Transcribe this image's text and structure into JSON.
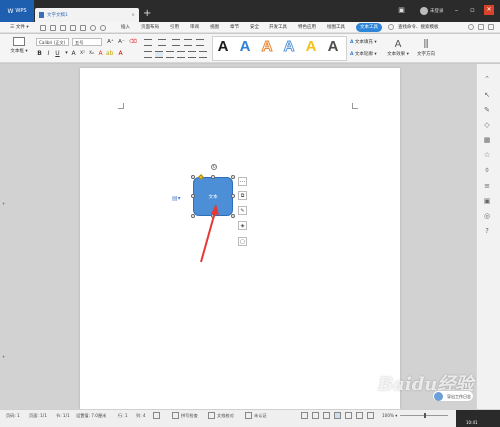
{
  "titlebar": {
    "app_tab": "WPS",
    "doc_tab": "文字文稿1",
    "unlogin": "未登录"
  },
  "menu": {
    "file": "三 文件 ▾",
    "items": [
      "插入",
      "页面布局",
      "引用",
      "审阅",
      "视图",
      "章节",
      "安全",
      "开发工具",
      "特色应用",
      "绘图工具"
    ],
    "active": "文本工具",
    "search": "查找命令、搜索模板"
  },
  "ribbon": {
    "textbox": "文本框 ▾",
    "font": "Calibri (正文)",
    "size": "五号",
    "text_fill": "文本填充 ▾",
    "text_outline": "文本轮廓 ▾",
    "text_effect": "文本效果 ▾",
    "text_direction": "文字方向",
    "styles": [
      {
        "glyph": "A",
        "color": "#1a1a1a",
        "style": "solid"
      },
      {
        "glyph": "A",
        "color": "#2f7fd4",
        "style": "solid"
      },
      {
        "glyph": "A",
        "color": "#e88432",
        "style": "outline"
      },
      {
        "glyph": "A",
        "color": "#5b97d9",
        "style": "outline"
      },
      {
        "glyph": "A",
        "color": "#f2c318",
        "style": "solid"
      },
      {
        "glyph": "A",
        "color": "#4d4d4d",
        "style": "solid"
      }
    ]
  },
  "canvas": {
    "shape_text": "文本"
  },
  "statusbar": {
    "page_num": "页码: 1",
    "pages": "页面: 1/1",
    "section": "节: 1/1",
    "setting": "设置值: 7.0厘米",
    "row": "行: 1",
    "col": "列: 4",
    "spell": "拼写检查",
    "doc_check": "文档校对",
    "unverified": "未认证",
    "zoom": "100% ▾",
    "clock": "10:41"
  },
  "help": {
    "label": "导出工作日志"
  },
  "watermark": "Baidu经验",
  "colors": {
    "accent": "#2f86d9",
    "shape_fill": "#4d8fd6",
    "arrow": "#e53935"
  },
  "icons": {
    "right_bar": [
      "arrow-up",
      "cursor",
      "pen",
      "shape",
      "grid",
      "star",
      "clip",
      "list",
      "image",
      "target",
      "help"
    ]
  }
}
